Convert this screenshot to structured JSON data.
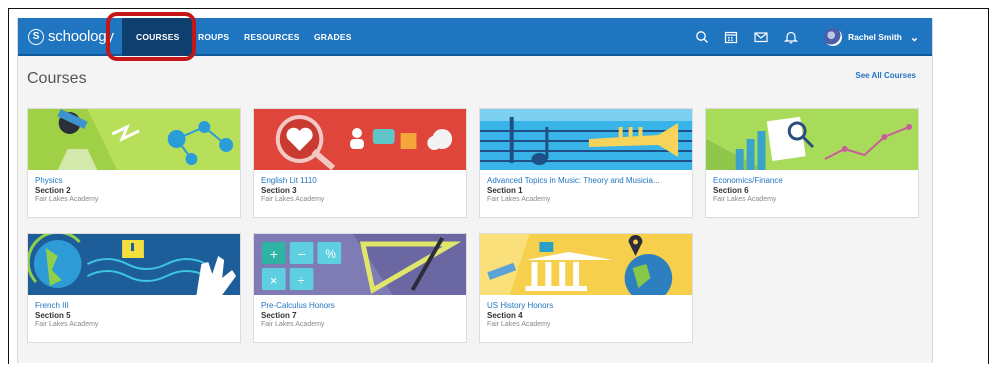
{
  "app": {
    "logo_text": "schoology",
    "brand_color": "#1f75c0"
  },
  "nav": {
    "tabs": [
      {
        "label": "COURSES",
        "active": true
      },
      {
        "label": "ROUPS"
      },
      {
        "label": "RESOURCES"
      },
      {
        "label": "GRADES"
      }
    ],
    "icons": [
      "search-icon",
      "calendar-icon",
      "mail-icon",
      "bell-icon"
    ],
    "user_name": "Rachel Smith"
  },
  "main": {
    "title": "Courses",
    "see_all": "See All Courses",
    "courses": [
      {
        "name": "Physics",
        "section": "Section 2",
        "school": "Fair Lakes Academy",
        "art": "physics"
      },
      {
        "name": "English Lit 1110",
        "section": "Section 3",
        "school": "Fair Lakes Academy",
        "art": "english"
      },
      {
        "name": "Advanced Topics in Music: Theory and Musicia...",
        "section": "Section 1",
        "school": "Fair Lakes Academy",
        "art": "music"
      },
      {
        "name": "Economics/Finance",
        "section": "Section 6",
        "school": "Fair Lakes Academy",
        "art": "economics"
      },
      {
        "name": "French III",
        "section": "Section 5",
        "school": "Fair Lakes Academy",
        "art": "french"
      },
      {
        "name": "Pre-Calculus Honors",
        "section": "Section 7",
        "school": "Fair Lakes Academy",
        "art": "math"
      },
      {
        "name": "US History Honors",
        "section": "Section 4",
        "school": "Fair Lakes Academy",
        "art": "history"
      }
    ]
  }
}
